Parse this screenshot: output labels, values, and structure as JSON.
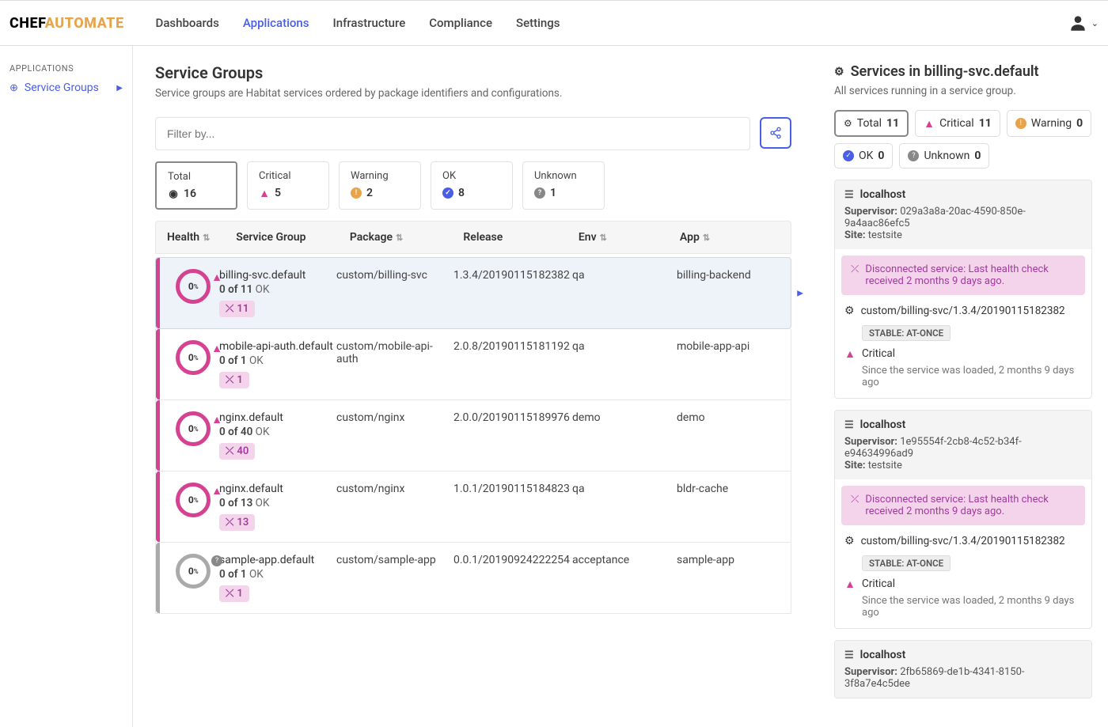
{
  "brand": {
    "chef": "CHEF",
    "automate": "AUTOMATE"
  },
  "nav": {
    "items": [
      "Dashboards",
      "Applications",
      "Infrastructure",
      "Compliance",
      "Settings"
    ],
    "active": 1
  },
  "sidebar": {
    "section": "APPLICATIONS",
    "item": "Service Groups"
  },
  "page": {
    "title": "Service Groups",
    "subtitle": "Service groups are Habitat services ordered by package identifiers and configurations.",
    "filter_placeholder": "Filter by..."
  },
  "stats": {
    "total": {
      "label": "Total",
      "value": "16"
    },
    "critical": {
      "label": "Critical",
      "value": "5"
    },
    "warning": {
      "label": "Warning",
      "value": "2"
    },
    "ok": {
      "label": "OK",
      "value": "8"
    },
    "unknown": {
      "label": "Unknown",
      "value": "1"
    }
  },
  "columns": {
    "health": "Health",
    "sg": "Service Group",
    "pkg": "Package",
    "rel": "Release",
    "env": "Env",
    "app": "App"
  },
  "rows": [
    {
      "pct": "0",
      "status": "crit",
      "name": "billing-svc.default",
      "of": "0 of 11",
      "disc": "11",
      "pkg": "custom/billing-svc",
      "rel": "1.3.4/20190115182382",
      "env": "qa",
      "app": "billing-backend",
      "selected": true
    },
    {
      "pct": "0",
      "status": "crit",
      "name": "mobile-api-auth.default",
      "of": "0 of 1",
      "disc": "1",
      "pkg": "custom/mobile-api-auth",
      "rel": "2.0.8/20190115181192",
      "env": "qa",
      "app": "mobile-app-api"
    },
    {
      "pct": "0",
      "status": "crit",
      "name": "nginx.default",
      "of": "0 of 40",
      "disc": "40",
      "pkg": "custom/nginx",
      "rel": "2.0.0/20190115189976",
      "env": "demo",
      "app": "demo"
    },
    {
      "pct": "0",
      "status": "crit",
      "name": "nginx.default",
      "of": "0 of 13",
      "disc": "13",
      "pkg": "custom/nginx",
      "rel": "1.0.1/20190115184823",
      "env": "qa",
      "app": "bldr-cache"
    },
    {
      "pct": "0",
      "status": "unk",
      "name": "sample-app.default",
      "of": "0 of 1",
      "disc": "1",
      "pkg": "custom/sample-app",
      "rel": "0.0.1/20190924222254",
      "env": "acceptance",
      "app": "sample-app"
    }
  ],
  "detail": {
    "title": "Services in billing-svc.default",
    "subtitle": "All services running in a service group.",
    "chips": {
      "total": {
        "label": "Total",
        "count": "11"
      },
      "critical": {
        "label": "Critical",
        "count": "11"
      },
      "warning": {
        "label": "Warning",
        "count": "0"
      },
      "ok": {
        "label": "OK",
        "count": "0"
      },
      "unknown": {
        "label": "Unknown",
        "count": "0"
      }
    },
    "services": [
      {
        "host": "localhost",
        "supervisor": "029a3a8a-20ac-4590-850e-9a4aac86efc5",
        "site": "testsite",
        "banner": "Disconnected service: Last health check received 2 months 9 days ago.",
        "pkg": "custom/billing-svc/1.3.4/20190115182382",
        "tag": "STABLE: AT-ONCE",
        "state": "Critical",
        "since": "Since the service was loaded, 2 months 9 days ago"
      },
      {
        "host": "localhost",
        "supervisor": "1e95554f-2cb8-4c52-b34f-e94634996ad9",
        "site": "testsite",
        "banner": "Disconnected service: Last health check received 2 months 9 days ago.",
        "pkg": "custom/billing-svc/1.3.4/20190115182382",
        "tag": "STABLE: AT-ONCE",
        "state": "Critical",
        "since": "Since the service was loaded, 2 months 9 days ago"
      },
      {
        "host": "localhost",
        "supervisor": "2fb65869-de1b-4341-8150-3f8a7e4c5dee",
        "site": "",
        "banner": "",
        "pkg": "",
        "tag": "",
        "state": "",
        "since": ""
      }
    ],
    "labels": {
      "supervisor": "Supervisor:",
      "site": "Site:"
    }
  }
}
